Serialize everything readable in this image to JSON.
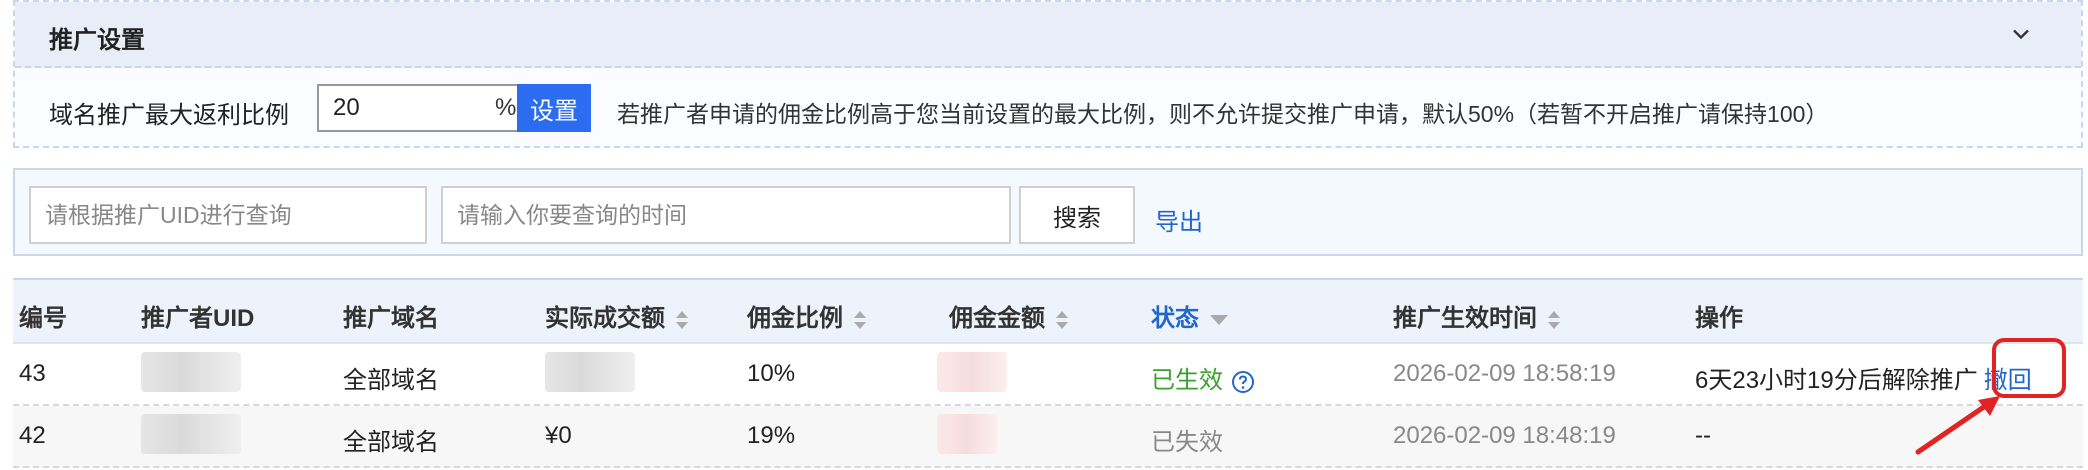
{
  "settings": {
    "title": "推广设置",
    "label": "域名推广最大返利比例",
    "ratio_value": "20",
    "percent_sign": "%",
    "set_button": "设置",
    "hint": "若推广者申请的佣金比例高于您当前设置的最大比例，则不允许提交推广申请，默认50%（若暂不开启推广请保持100）"
  },
  "search": {
    "uid_placeholder": "请根据推广UID进行查询",
    "time_placeholder": "请输入你要查询的时间",
    "search_button": "搜索",
    "export_link": "导出"
  },
  "table": {
    "headers": {
      "id": "编号",
      "uid": "推广者UID",
      "domain": "推广域名",
      "amount": "实际成交额",
      "ratio": "佣金比例",
      "commission": "佣金金额",
      "status": "状态",
      "effective_time": "推广生效时间",
      "action": "操作"
    },
    "rows": [
      {
        "id": "43",
        "domain": "全部域名",
        "ratio": "10%",
        "status": "已生效",
        "effective_time": "2026-02-09 18:58:19",
        "action_text": "6天23小时19分后解除推广",
        "action_link": "撤回"
      },
      {
        "id": "42",
        "domain": "全部域名",
        "amount": "¥0",
        "ratio": "19%",
        "status": "已失效",
        "effective_time": "2026-02-09 18:48:19",
        "action_text": "--"
      }
    ]
  },
  "colors": {
    "accent": "#2b6cf0",
    "link": "#2266cc",
    "active_status": "#3aa02e",
    "highlight": "#e02424"
  }
}
